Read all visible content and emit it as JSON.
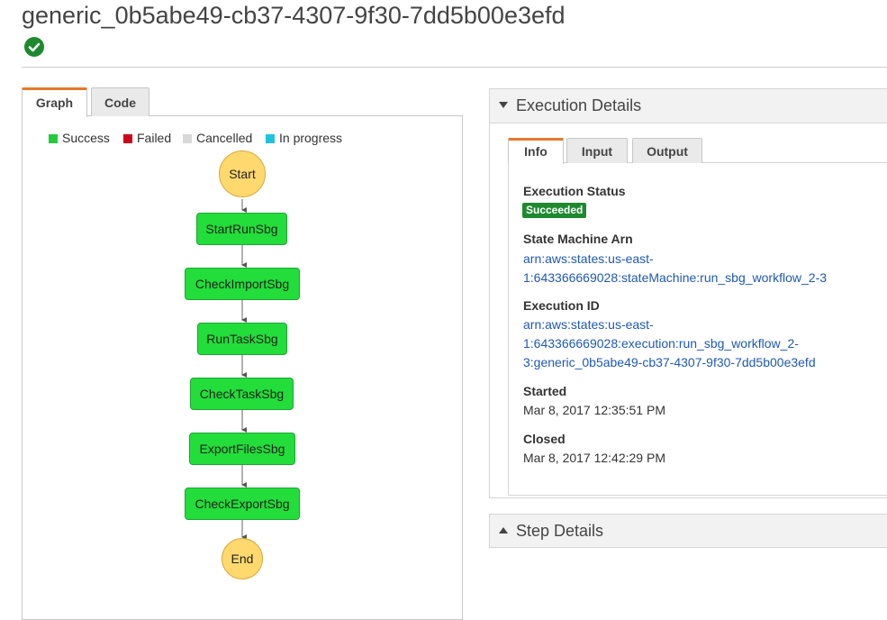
{
  "execution": {
    "title": "generic_0b5abe49-cb37-4307-9f30-7dd5b00e3efd",
    "status_icon": "success-check-icon"
  },
  "graph_tabs": [
    "Graph",
    "Code"
  ],
  "legend": [
    {
      "label": "Success",
      "color": "#22cc3a"
    },
    {
      "label": "Failed",
      "color": "#d0021b"
    },
    {
      "label": "Cancelled",
      "color": "#d8d8d8"
    },
    {
      "label": "In progress",
      "color": "#1fc3e0"
    }
  ],
  "graph": {
    "start": "Start",
    "states": [
      "StartRunSbg",
      "CheckImportSbg",
      "RunTaskSbg",
      "CheckTaskSbg",
      "ExportFilesSbg",
      "CheckExportSbg"
    ],
    "end": "End"
  },
  "execution_details": {
    "header": "Execution Details",
    "tabs": [
      "Info",
      "Input",
      "Output"
    ],
    "status_label": "Execution Status",
    "status_value": "Succeeded",
    "arn_label": "State Machine Arn",
    "arn_lines": [
      "arn:aws:states:us-east-",
      "1:643366669028:stateMachine:run_sbg_workflow_2-3"
    ],
    "exec_id_label": "Execution ID",
    "exec_id_lines": [
      "arn:aws:states:us-east-",
      "1:643366669028:execution:run_sbg_workflow_2-",
      "3:generic_0b5abe49-cb37-4307-9f30-7dd5b00e3efd"
    ],
    "started_label": "Started",
    "started_value": "Mar 8, 2017 12:35:51 PM",
    "closed_label": "Closed",
    "closed_value": "Mar 8, 2017 12:42:29 PM"
  },
  "step_details": {
    "header": "Step Details"
  }
}
